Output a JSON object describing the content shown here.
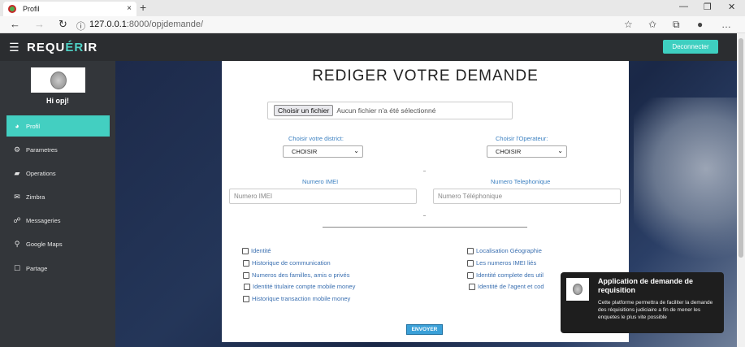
{
  "browser": {
    "tab_title": "Profil",
    "tab_close": "×",
    "new_tab": "+",
    "url_host": "127.0.0.1",
    "url_path": ":8000/opjdemande/",
    "back": "←",
    "forward": "→",
    "reload": "↻",
    "info": "ⓘ",
    "minimize": "—",
    "restore": "❐",
    "close": "✕"
  },
  "header": {
    "brand_prefix": "REQU",
    "brand_accent": "ÉR",
    "brand_suffix": "IR",
    "logout_label": "Deconnecter"
  },
  "sidebar": {
    "greeting": "Hi opj!",
    "items": [
      {
        "label": "Profil",
        "icon": "dashboard-icon",
        "active": true
      },
      {
        "label": "Parametres",
        "icon": "gears-icon"
      },
      {
        "label": "Operations",
        "icon": "book-icon"
      },
      {
        "label": "Zimbra",
        "icon": "envelope-icon"
      },
      {
        "label": "Messageries",
        "icon": "chat-icon"
      },
      {
        "label": "Google Maps",
        "icon": "map-marker-icon"
      },
      {
        "label": "Partage",
        "icon": "square-icon"
      }
    ]
  },
  "form": {
    "title": "REDIGER VOTRE DEMANDE",
    "file_button": "Choisir un fichier",
    "file_status": "Aucun fichier n'a été sélectionné",
    "district_label": "Choisir votre district:",
    "district_value": "CHOISIR",
    "operator_label": "Choisir l'Operateur:",
    "operator_value": "CHOISIR",
    "imei_label": "Numero IMEI",
    "imei_placeholder": "Numero IMEI",
    "phone_label": "Numero Telephonique",
    "phone_placeholder": "Numero Téléphonique",
    "checkboxes_left": [
      "Identité",
      "Historique de communication",
      "Numeros des familles, amis o privés",
      "Identité titulaire compte mobile money",
      "Historique transaction mobile money"
    ],
    "checkboxes_right": [
      "Localisation Géographie",
      "Les numeros IMEI liés",
      "Identité complete des util",
      "Identité de l'agent et cod"
    ],
    "submit_label": "ENVOYER"
  },
  "toast": {
    "title": "Application de demande de requisition",
    "body": "Cette platforme permettra de faciliter la demande des réquisitions judiciaire a fin de mener les enquetes le plus vite possible"
  }
}
